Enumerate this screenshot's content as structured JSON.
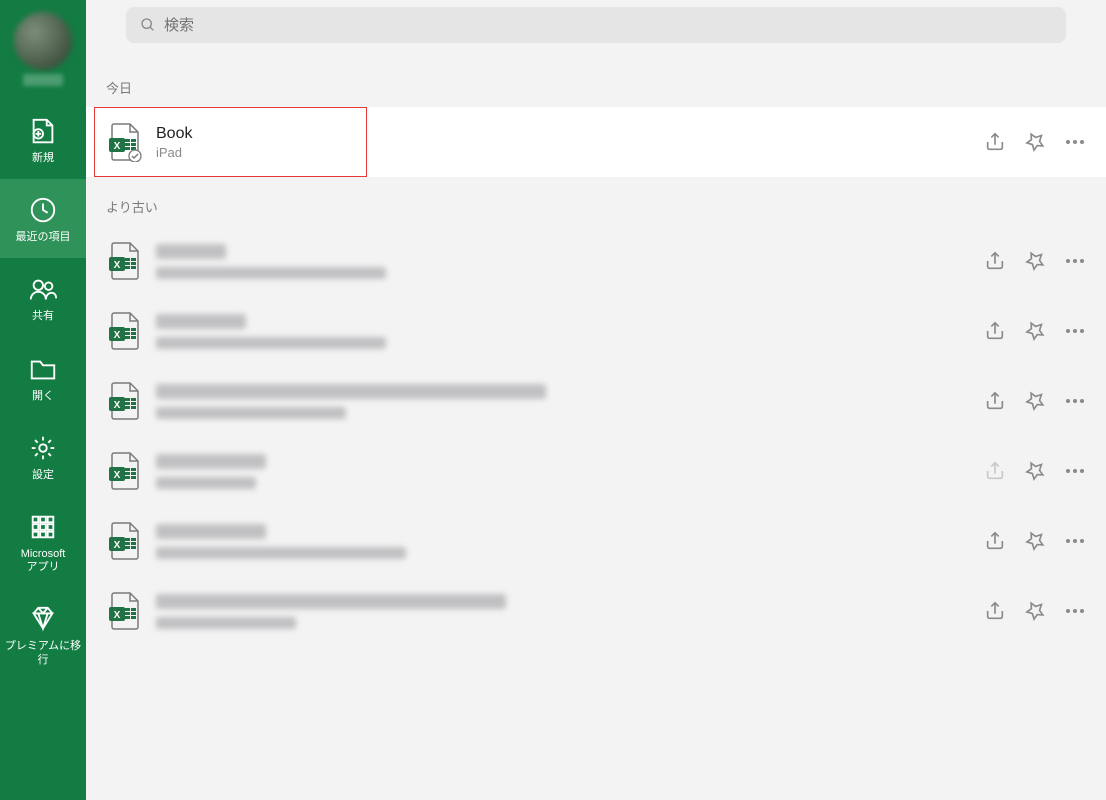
{
  "search": {
    "placeholder": "検索"
  },
  "sidebar": {
    "items": [
      {
        "label": "新規"
      },
      {
        "label": "最近の項目"
      },
      {
        "label": "共有"
      },
      {
        "label": "開く"
      },
      {
        "label": "設定"
      },
      {
        "label": "Microsoft\nアプリ"
      },
      {
        "label": "プレミアムに移行"
      }
    ]
  },
  "sections": {
    "today": "今日",
    "older": "より古い"
  },
  "files": {
    "today": [
      {
        "title": "Book",
        "sub": "iPad"
      }
    ],
    "older_count": 6
  }
}
